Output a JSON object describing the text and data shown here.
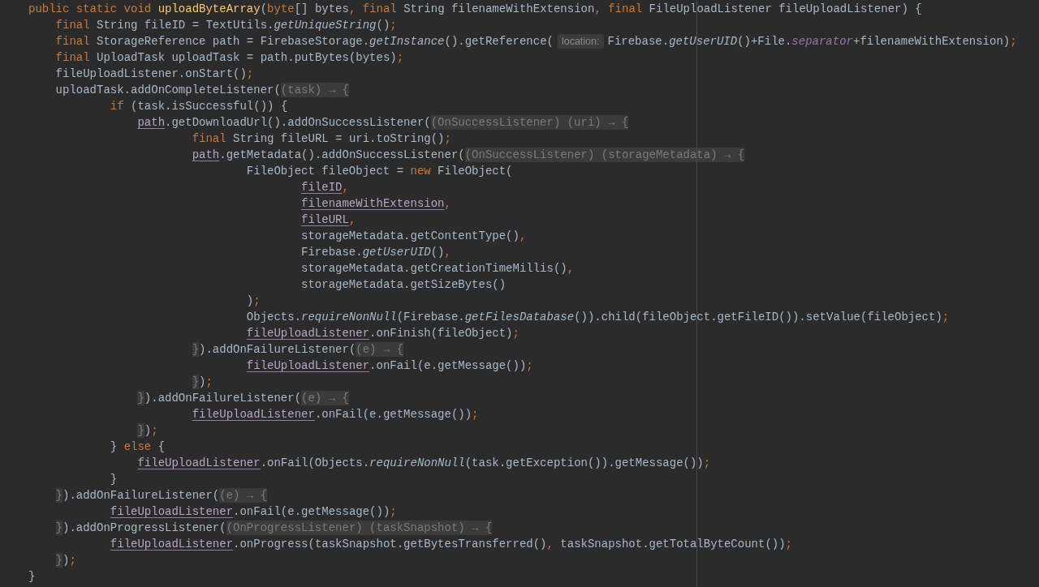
{
  "editor": {
    "lines": [
      {
        "tokens": [
          {
            "kind": "kw",
            "t": "public static void "
          },
          {
            "kind": "decl",
            "t": "uploadByteArray"
          },
          {
            "kind": "p",
            "t": "("
          },
          {
            "kind": "kw",
            "t": "byte"
          },
          {
            "kind": "p",
            "t": "[] bytes"
          },
          {
            "kind": "kw",
            "t": ", final "
          },
          {
            "kind": "p",
            "t": "String filenameWithExtension"
          },
          {
            "kind": "kw",
            "t": ", final "
          },
          {
            "kind": "p",
            "t": "FileUploadListener fileUploadListener) {"
          }
        ]
      },
      {
        "tokens": [
          {
            "kind": "kw",
            "t": "    final "
          },
          {
            "kind": "p",
            "t": "String fileID = TextUtils."
          },
          {
            "kind": "it",
            "t": "getUniqueString"
          },
          {
            "kind": "p",
            "t": "()"
          },
          {
            "kind": "semi",
            "t": ";"
          }
        ]
      },
      {
        "tokens": [
          {
            "kind": "kw",
            "t": "    final "
          },
          {
            "kind": "p",
            "t": "StorageReference path = FirebaseStorage."
          },
          {
            "kind": "it",
            "t": "getInstance"
          },
          {
            "kind": "p",
            "t": "().getReference("
          },
          {
            "kind": "hint",
            "t": "location:"
          },
          {
            "kind": "p",
            "t": "Firebase."
          },
          {
            "kind": "it",
            "t": "getUserUID"
          },
          {
            "kind": "p",
            "t": "()+File."
          },
          {
            "kind": "field",
            "t": "separator"
          },
          {
            "kind": "p",
            "t": "+filenameWithExtension)"
          },
          {
            "kind": "semi",
            "t": ";"
          }
        ]
      },
      {
        "tokens": [
          {
            "kind": "kw",
            "t": "    final "
          },
          {
            "kind": "p",
            "t": "UploadTask uploadTask = path.putBytes(bytes)"
          },
          {
            "kind": "semi",
            "t": ";"
          }
        ]
      },
      {
        "tokens": [
          {
            "kind": "p",
            "t": "    fileUploadListener.onStart()"
          },
          {
            "kind": "semi",
            "t": ";"
          }
        ]
      },
      {
        "tokens": [
          {
            "kind": "p",
            "t": "    uploadTask.addOnCompleteListener("
          },
          {
            "kind": "fold",
            "t": "(task) → {"
          }
        ]
      },
      {
        "tokens": [
          {
            "kind": "kw",
            "t": "            if "
          },
          {
            "kind": "p",
            "t": "(task.isSuccessful()) {"
          }
        ]
      },
      {
        "tokens": [
          {
            "kind": "ul",
            "t": "                path"
          },
          {
            "kind": "p",
            "t": ".getDownloadUrl().addOnSuccessListener("
          },
          {
            "kind": "fold",
            "t": "(OnSuccessListener) (uri) → {"
          }
        ]
      },
      {
        "tokens": [
          {
            "kind": "kw",
            "t": "                        final "
          },
          {
            "kind": "p",
            "t": "String fileURL = uri.toString()"
          },
          {
            "kind": "semi",
            "t": ";"
          }
        ]
      },
      {
        "tokens": [
          {
            "kind": "ul",
            "t": "                        path"
          },
          {
            "kind": "p",
            "t": ".getMetadata().addOnSuccessListener("
          },
          {
            "kind": "fold",
            "t": "(OnSuccessListener) (storageMetadata) → {"
          }
        ]
      },
      {
        "tokens": [
          {
            "kind": "p",
            "t": "                                FileObject fileObject = "
          },
          {
            "kind": "kw",
            "t": "new "
          },
          {
            "kind": "p",
            "t": "FileObject("
          }
        ]
      },
      {
        "tokens": [
          {
            "kind": "ul",
            "t": "                                        fileID"
          },
          {
            "kind": "semi",
            "t": ","
          }
        ]
      },
      {
        "tokens": [
          {
            "kind": "ul",
            "t": "                                        filenameWithExtension"
          },
          {
            "kind": "semi",
            "t": ","
          }
        ]
      },
      {
        "tokens": [
          {
            "kind": "ul",
            "t": "                                        fileURL"
          },
          {
            "kind": "semi",
            "t": ","
          }
        ]
      },
      {
        "tokens": [
          {
            "kind": "p",
            "t": "                                        storageMetadata.getContentType()"
          },
          {
            "kind": "semi",
            "t": ","
          }
        ]
      },
      {
        "tokens": [
          {
            "kind": "p",
            "t": "                                        Firebase."
          },
          {
            "kind": "it",
            "t": "getUserUID"
          },
          {
            "kind": "p",
            "t": "()"
          },
          {
            "kind": "semi",
            "t": ","
          }
        ]
      },
      {
        "tokens": [
          {
            "kind": "p",
            "t": "                                        storageMetadata.getCreationTimeMillis()"
          },
          {
            "kind": "semi",
            "t": ","
          }
        ]
      },
      {
        "tokens": [
          {
            "kind": "p",
            "t": "                                        storageMetadata.getSizeBytes()"
          }
        ]
      },
      {
        "tokens": [
          {
            "kind": "p",
            "t": "                                )"
          },
          {
            "kind": "semi",
            "t": ";"
          }
        ]
      },
      {
        "tokens": [
          {
            "kind": "p",
            "t": "                                Objects."
          },
          {
            "kind": "it",
            "t": "requireNonNull"
          },
          {
            "kind": "p",
            "t": "(Firebase."
          },
          {
            "kind": "it",
            "t": "getFilesDatabase"
          },
          {
            "kind": "p",
            "t": "()).child(fileObject.getFileID()).setValue(fileObject)"
          },
          {
            "kind": "semi",
            "t": ";"
          }
        ]
      },
      {
        "tokens": [
          {
            "kind": "ul",
            "t": "                                fileUploadListener"
          },
          {
            "kind": "p",
            "t": ".onFinish(fileObject)"
          },
          {
            "kind": "semi",
            "t": ";"
          }
        ]
      },
      {
        "tokens": [
          {
            "kind": "fold",
            "t": "                        }"
          },
          {
            "kind": "p",
            "t": ").addOnFailureListener("
          },
          {
            "kind": "fold",
            "t": "(e) → {"
          }
        ]
      },
      {
        "tokens": [
          {
            "kind": "ul",
            "t": "                                fileUploadListener"
          },
          {
            "kind": "p",
            "t": ".onFail(e.getMessage())"
          },
          {
            "kind": "semi",
            "t": ";"
          }
        ]
      },
      {
        "tokens": [
          {
            "kind": "fold",
            "t": "                        }"
          },
          {
            "kind": "p",
            "t": ")"
          },
          {
            "kind": "semi",
            "t": ";"
          }
        ]
      },
      {
        "tokens": [
          {
            "kind": "fold",
            "t": "                }"
          },
          {
            "kind": "p",
            "t": ").addOnFailureListener("
          },
          {
            "kind": "fold",
            "t": "(e) → {"
          }
        ]
      },
      {
        "tokens": [
          {
            "kind": "ul",
            "t": "                        fileUploadListener"
          },
          {
            "kind": "p",
            "t": ".onFail(e.getMessage())"
          },
          {
            "kind": "semi",
            "t": ";"
          }
        ]
      },
      {
        "tokens": [
          {
            "kind": "fold",
            "t": "                }"
          },
          {
            "kind": "p",
            "t": ")"
          },
          {
            "kind": "semi",
            "t": ";"
          }
        ]
      },
      {
        "tokens": [
          {
            "kind": "p",
            "t": "            } "
          },
          {
            "kind": "kw",
            "t": "else "
          },
          {
            "kind": "p",
            "t": "{"
          }
        ]
      },
      {
        "tokens": [
          {
            "kind": "ul",
            "t": "                fileUploadListener"
          },
          {
            "kind": "p",
            "t": ".onFail(Objects."
          },
          {
            "kind": "it",
            "t": "requireNonNull"
          },
          {
            "kind": "p",
            "t": "(task.getException()).getMessage())"
          },
          {
            "kind": "semi",
            "t": ";"
          }
        ]
      },
      {
        "tokens": [
          {
            "kind": "p",
            "t": "            }"
          }
        ]
      },
      {
        "tokens": [
          {
            "kind": "fold",
            "t": "    }"
          },
          {
            "kind": "p",
            "t": ").addOnFailureListener("
          },
          {
            "kind": "fold",
            "t": "(e) → {"
          }
        ]
      },
      {
        "tokens": [
          {
            "kind": "ul",
            "t": "            fileUploadListener"
          },
          {
            "kind": "p",
            "t": ".onFail(e.getMessage())"
          },
          {
            "kind": "semi",
            "t": ";"
          }
        ]
      },
      {
        "tokens": [
          {
            "kind": "fold",
            "t": "    }"
          },
          {
            "kind": "p",
            "t": ").addOnProgressListener("
          },
          {
            "kind": "fold",
            "t": "(OnProgressListener) (taskSnapshot) → {"
          }
        ]
      },
      {
        "tokens": [
          {
            "kind": "ul",
            "t": "            fileUploadListener"
          },
          {
            "kind": "p",
            "t": ".onProgress(taskSnapshot.getBytesTransferred()"
          },
          {
            "kind": "semi",
            "t": ","
          },
          {
            "kind": "p",
            "t": " taskSnapshot.getTotalByteCount())"
          },
          {
            "kind": "semi",
            "t": ";"
          }
        ]
      },
      {
        "tokens": [
          {
            "kind": "fold",
            "t": "    }"
          },
          {
            "kind": "p",
            "t": ")"
          },
          {
            "kind": "semi",
            "t": ";"
          }
        ]
      },
      {
        "tokens": [
          {
            "kind": "p",
            "t": "}"
          }
        ]
      }
    ]
  }
}
